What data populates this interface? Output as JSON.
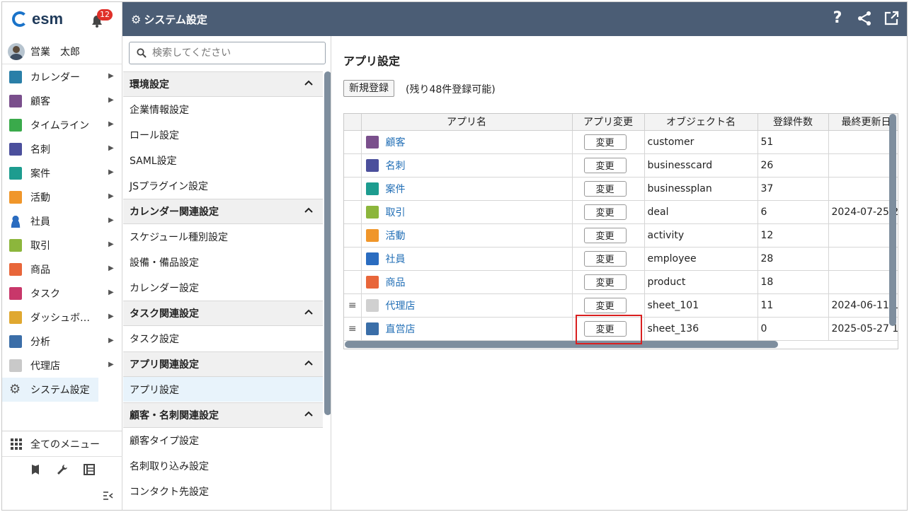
{
  "brand": {
    "logo": "esm",
    "notifications": "12"
  },
  "user": {
    "name": "営業　太郎"
  },
  "nav": {
    "items": [
      {
        "label": "カレンダー",
        "icon": "calendar-icon",
        "color": "#2a7fa8",
        "arrow": "▶"
      },
      {
        "label": "顧客",
        "icon": "building-icon",
        "color": "#7a4f8c",
        "arrow": "▶"
      },
      {
        "label": "タイムライン",
        "icon": "chat-icon",
        "color": "#3aaa4b",
        "arrow": "▶"
      },
      {
        "label": "名刺",
        "icon": "card-icon",
        "color": "#4b4f9c",
        "arrow": "▶"
      },
      {
        "label": "案件",
        "icon": "folder-icon",
        "color": "#1d9c8f",
        "arrow": "▶"
      },
      {
        "label": "活動",
        "icon": "clipboard-icon",
        "color": "#f0962a",
        "arrow": "▶"
      },
      {
        "label": "社員",
        "icon": "person-icon",
        "color": "#2a6cc0",
        "arrow": "▶"
      },
      {
        "label": "取引",
        "icon": "ledger-icon",
        "color": "#8cb63c",
        "arrow": "▶"
      },
      {
        "label": "商品",
        "icon": "box-icon",
        "color": "#e8663a",
        "arrow": "▶"
      },
      {
        "label": "タスク",
        "icon": "check-icon",
        "color": "#c8376a",
        "arrow": "▶"
      },
      {
        "label": "ダッシュボ…",
        "icon": "dashboard-icon",
        "color": "#e0a830",
        "arrow": "▶"
      },
      {
        "label": "分析",
        "icon": "chart-icon",
        "color": "#3b6ea8",
        "arrow": "▶"
      },
      {
        "label": "代理店",
        "icon": "document-icon",
        "color": "#c9c9c9",
        "arrow": "▶"
      },
      {
        "label": "システム設定",
        "icon": "gear-icon",
        "color": "#555555",
        "arrow": ""
      }
    ],
    "all_menu": "全てのメニュー"
  },
  "header": {
    "title": "システム設定"
  },
  "search": {
    "placeholder": "検索してください"
  },
  "settings": {
    "sections": [
      {
        "title": "環境設定",
        "items": [
          "企業情報設定",
          "ロール設定",
          "SAML設定",
          "JSプラグイン設定"
        ]
      },
      {
        "title": "カレンダー関連設定",
        "items": [
          "スケジュール種別設定",
          "設備・備品設定",
          "カレンダー設定"
        ]
      },
      {
        "title": "タスク関連設定",
        "items": [
          "タスク設定"
        ]
      },
      {
        "title": "アプリ関連設定",
        "items": [
          "アプリ設定"
        ]
      },
      {
        "title": "顧客・名刺関連設定",
        "items": [
          "顧客タイプ設定",
          "名刺取り込み設定",
          "コンタクト先設定"
        ]
      }
    ],
    "active": "アプリ設定"
  },
  "main": {
    "title": "アプリ設定",
    "new_button": "新規登録",
    "remaining": "(残り48件登録可能)",
    "columns": [
      "アプリ名",
      "アプリ変更",
      "オブジェクト名",
      "登録件数",
      "最終更新日"
    ],
    "change_label": "変更",
    "rows": [
      {
        "name": "顧客",
        "icon_color": "#7a4f8c",
        "object": "customer",
        "count": "51",
        "updated": "",
        "handle": false
      },
      {
        "name": "名刺",
        "icon_color": "#4b4f9c",
        "object": "businesscard",
        "count": "26",
        "updated": "",
        "handle": false
      },
      {
        "name": "案件",
        "icon_color": "#1d9c8f",
        "object": "businessplan",
        "count": "37",
        "updated": "",
        "handle": false
      },
      {
        "name": "取引",
        "icon_color": "#8cb63c",
        "object": "deal",
        "count": "6",
        "updated": "2024-07-25 2",
        "handle": false
      },
      {
        "name": "活動",
        "icon_color": "#f0962a",
        "object": "activity",
        "count": "12",
        "updated": "",
        "handle": false
      },
      {
        "name": "社員",
        "icon_color": "#2a6cc0",
        "object": "employee",
        "count": "28",
        "updated": "",
        "handle": false
      },
      {
        "name": "商品",
        "icon_color": "#e8663a",
        "object": "product",
        "count": "18",
        "updated": "",
        "handle": false
      },
      {
        "name": "代理店",
        "icon_color": "#d0d0d0",
        "object": "sheet_101",
        "count": "11",
        "updated": "2024-06-11 1",
        "handle": true
      },
      {
        "name": "直営店",
        "icon_color": "#3a6ea8",
        "object": "sheet_136",
        "count": "0",
        "updated": "2025-05-27 1",
        "handle": true
      }
    ]
  }
}
